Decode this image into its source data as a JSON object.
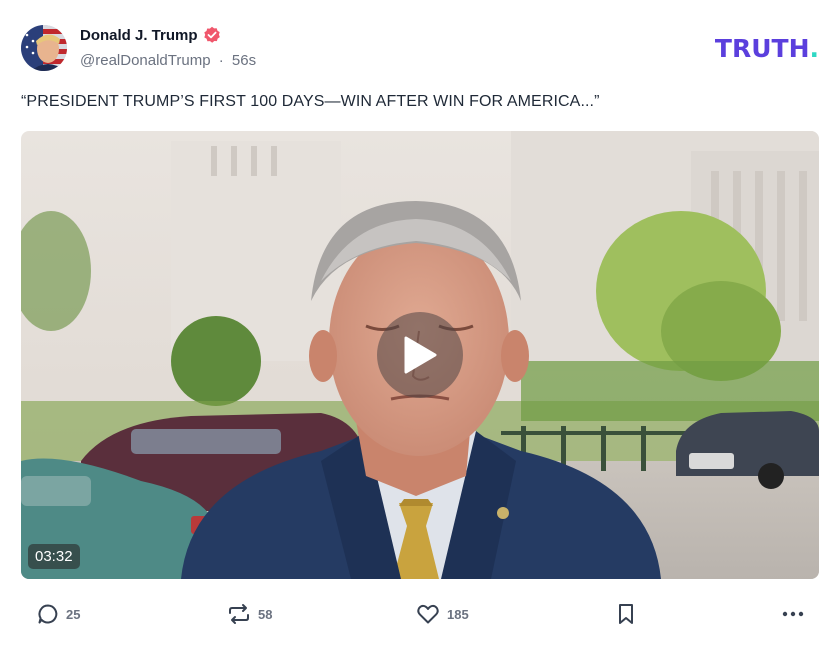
{
  "post": {
    "author_name": "Donald J. Trump",
    "handle": "@realDonaldTrump",
    "separator": "·",
    "time_ago": "56s",
    "verified_icon": "verified-badge-icon",
    "text": "“PRESIDENT TRUMP’S FIRST 100 DAYS—WIN AFTER WIN FOR AMERICA...”"
  },
  "brand": {
    "logo_text": "TRUTH",
    "logo_dot": ".",
    "logo_color": "#5b3fdd",
    "dot_color": "#2fd8c4"
  },
  "video": {
    "duration": "03:32",
    "play_icon": "play-icon"
  },
  "actions": {
    "replies": {
      "icon": "reply-bubble-icon",
      "count": "25"
    },
    "retruths": {
      "icon": "repost-icon",
      "count": "58"
    },
    "likes": {
      "icon": "heart-icon",
      "count": "185"
    },
    "bookmark": {
      "icon": "bookmark-icon"
    },
    "more": {
      "icon": "more-horizontal-icon"
    }
  },
  "colors": {
    "verified": "#f0576c",
    "muted_text": "#6b7280"
  }
}
